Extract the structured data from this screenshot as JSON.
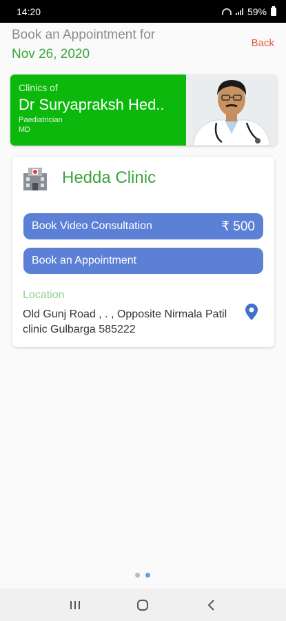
{
  "status_bar": {
    "time": "14:20",
    "battery": "59%"
  },
  "header": {
    "title": "Book an Appointment for",
    "date": "Nov 26, 2020",
    "back_label": "Back"
  },
  "doctor": {
    "clinics_of_label": "Clinics of",
    "name": "Dr Suryapraksh Hed..",
    "specialty": "Paediatrician",
    "degree": "MD"
  },
  "clinic": {
    "name": "Hedda Clinic",
    "icon": "hospital-icon",
    "video_button_label": "Book Video Consultation",
    "video_price": "₹ 500",
    "appointment_button_label": "Book an Appointment",
    "location_label": "Location",
    "address": "Old Gunj Road , . , Opposite Nirmala Patil clinic Gulbarga 585222"
  },
  "pager": {
    "count": 2,
    "active_index": 1
  },
  "colors": {
    "accent_green": "#0db80d",
    "button_blue": "#5c80d6",
    "back_red": "#e05c3c"
  }
}
